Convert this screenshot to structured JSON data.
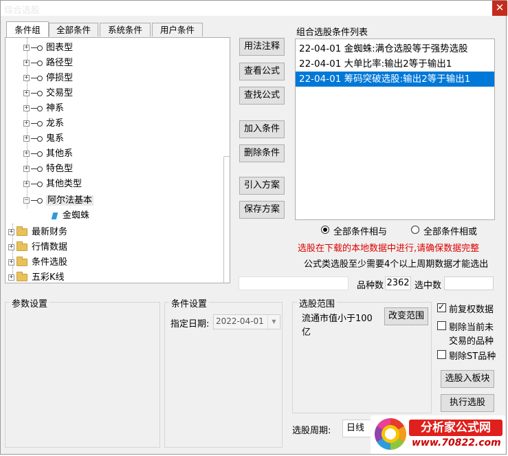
{
  "window": {
    "title": "综合选股",
    "close_glyph": "✕"
  },
  "tabs": [
    {
      "label": "条件组",
      "active": true
    },
    {
      "label": "全部条件",
      "active": false
    },
    {
      "label": "系统条件",
      "active": false
    },
    {
      "label": "用户条件",
      "active": false
    }
  ],
  "tree": {
    "formula_items": [
      "图表型",
      "路径型",
      "停损型",
      "交易型",
      "神系",
      "龙系",
      "鬼系",
      "其他系",
      "特色型",
      "其他类型"
    ],
    "expanded_item": "阿尔法基本",
    "leaf_item": "金蜘蛛",
    "folders": [
      "最新财务",
      "行情数据",
      "条件选股",
      "五彩K线"
    ],
    "icons": {
      "formula": "key-icon",
      "folder": "folder-icon",
      "leaf": "gem-icon",
      "expand": "plus-icon",
      "collapse": "minus-icon"
    }
  },
  "buttons": {
    "usage_notes": "用法注释",
    "view_formula": "查看公式",
    "find_formula": "查找公式",
    "add_condition": "加入条件",
    "delete_condition": "删除条件",
    "import_plan": "引入方案",
    "save_plan": "保存方案",
    "change_range": "改变范围",
    "add_to_block": "选股入板块",
    "execute": "执行选股"
  },
  "condition_list": {
    "label": "组合选股条件列表",
    "items": [
      {
        "text": "22-04-01 金蜘蛛:满仓选股等于强势选股",
        "selected": false
      },
      {
        "text": "22-04-01 大单比率:输出2等于输出1",
        "selected": false
      },
      {
        "text": "22-04-01 筹码突破选股:输出2等于输出1",
        "selected": true
      }
    ]
  },
  "logic": {
    "all_and": "全部条件相与",
    "all_or": "全部条件相或",
    "selected": "all_and"
  },
  "notices": {
    "warning": "选股在下载的本地数据中进行,请确保数据完整",
    "info": "公式类选股至少需要4个以上周期数据才能选出",
    "warning_color": "#e00000"
  },
  "stats": {
    "count_label": "品种数",
    "count_value": "2362",
    "selected_label": "选中数",
    "selected_value": ""
  },
  "params": {
    "title": "参数设置"
  },
  "condition_settings": {
    "title": "条件设置",
    "date_label": "指定日期:",
    "date_value": "2022-04-01"
  },
  "range": {
    "title": "选股范围",
    "description": "流通市值小于100亿"
  },
  "options": {
    "restore_rights": {
      "label": "前复权数据",
      "checked": true
    },
    "exclude_untraded": {
      "label": "剔除当前未交易的品种",
      "line1": "剔除当前未",
      "line2": "交易的品种",
      "checked": false
    },
    "exclude_st": {
      "label": "剔除ST品种",
      "checked": false
    }
  },
  "period": {
    "label": "选股周期:",
    "value": "日线"
  },
  "watermark": {
    "brand": "分析家公式网",
    "url": "www.70822.com"
  }
}
